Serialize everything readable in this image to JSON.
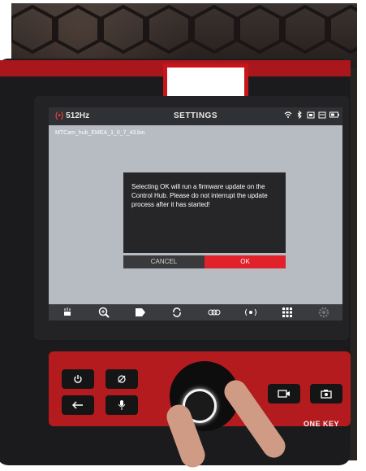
{
  "status_bar": {
    "frequency": "512Hz",
    "title": "SETTINGS",
    "icons": [
      "wifi-icon",
      "bluetooth-icon",
      "sd-card-icon",
      "storage-icon",
      "battery-icon"
    ]
  },
  "firmware": {
    "filename": "MTCam_hub_EMEA_1_0_7_43.bin"
  },
  "dialog": {
    "message": "Selecting OK will run a firmware update on the Control Hub. Please do not interrupt the update process after it has started!",
    "cancel_label": "CANCEL",
    "ok_label": "OK"
  },
  "toolbar": {
    "icons": [
      "light-icon",
      "zoom-in-icon",
      "tag-icon",
      "rotate-icon",
      "sonde-icon",
      "locate-icon",
      "grid-icon",
      "settings-icon"
    ]
  },
  "panel": {
    "buttons": [
      "power-icon",
      "no-signal-icon",
      "back-icon",
      "microphone-icon",
      "video-record-icon",
      "camera-icon"
    ],
    "brand": "ONE KEY"
  },
  "colors": {
    "accent_red": "#e2222a",
    "device_red": "#b41b1f",
    "screen_gray": "#b7bcc2"
  }
}
